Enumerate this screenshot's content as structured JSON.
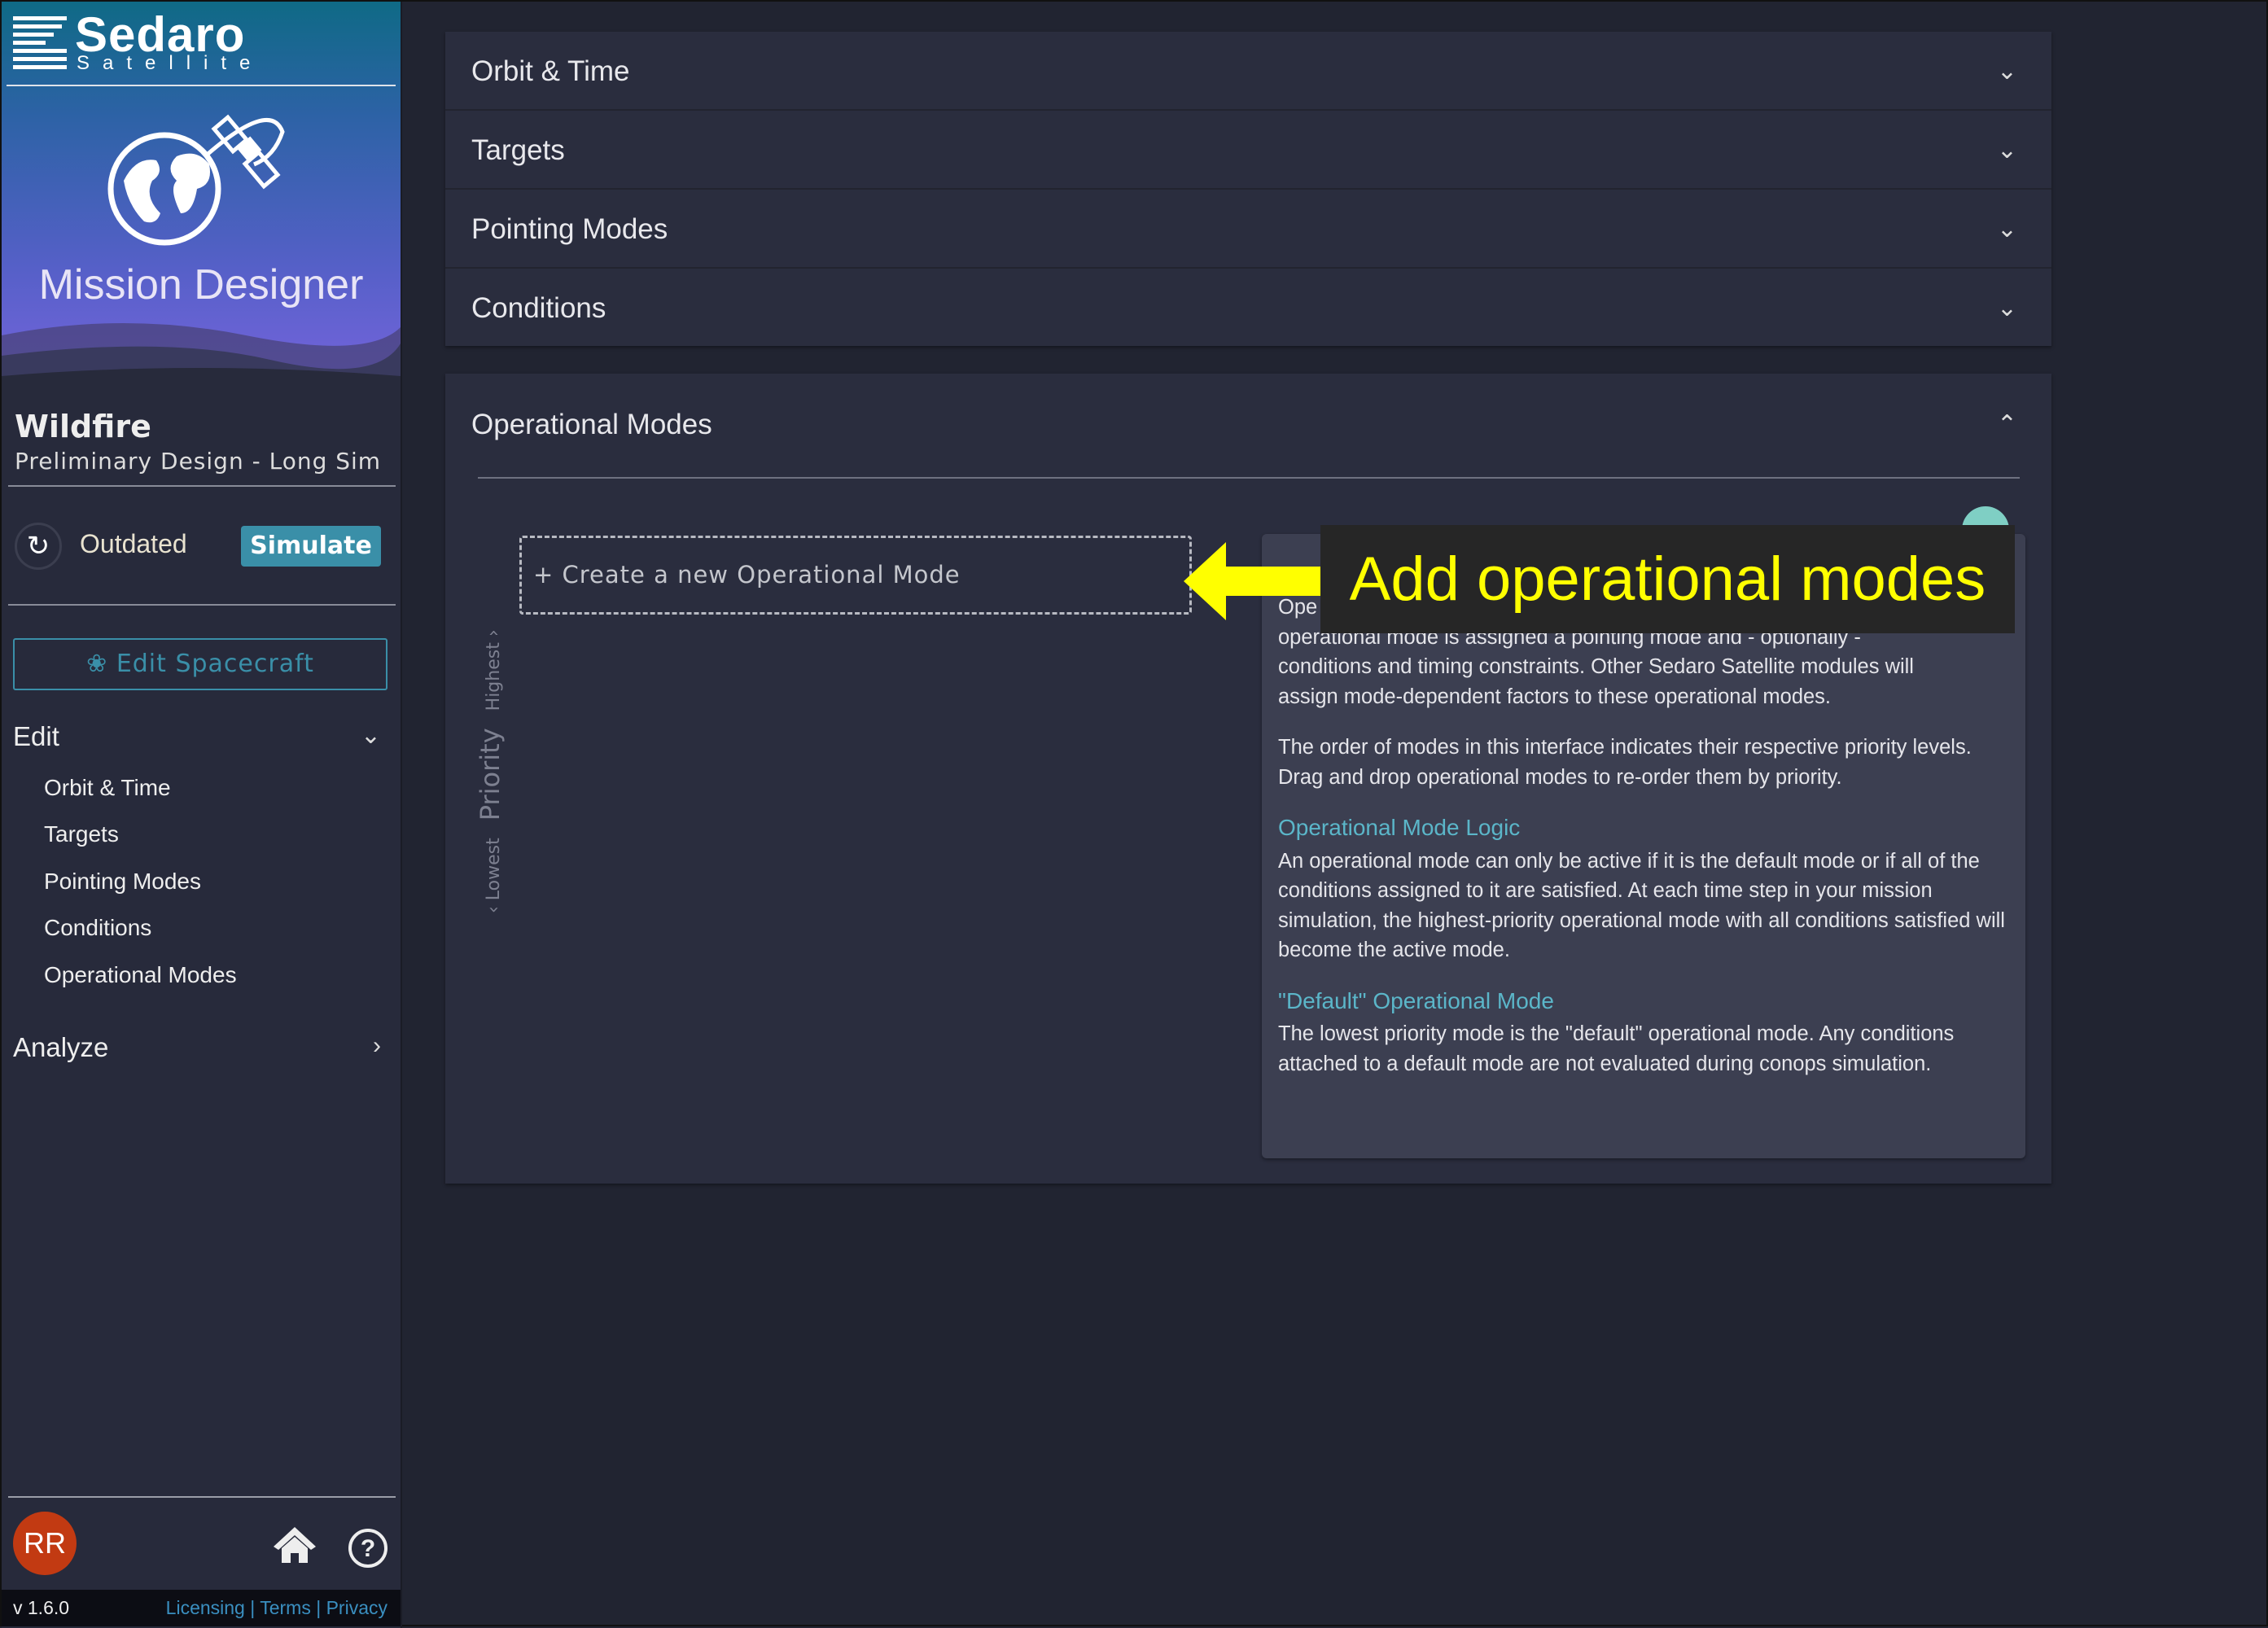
{
  "sidebar": {
    "logo": {
      "name": "Sedaro",
      "sub": "Satellite"
    },
    "app_title": "Mission Designer",
    "project": "Wildfire",
    "branch": "Preliminary Design - Long Sim",
    "status": "Outdated",
    "simulate_label": "Simulate",
    "edit_spacecraft_label": "Edit Spacecraft",
    "edit_section": {
      "label": "Edit",
      "items": [
        "Orbit & Time",
        "Targets",
        "Pointing Modes",
        "Conditions",
        "Operational Modes"
      ]
    },
    "analyze_label": "Analyze",
    "avatar_initials": "RR",
    "version": "v 1.6.0",
    "links": [
      "Licensing",
      "Terms",
      "Privacy"
    ]
  },
  "main": {
    "accordions": [
      "Orbit & Time",
      "Targets",
      "Pointing Modes",
      "Conditions"
    ],
    "operational_modes": {
      "title": "Operational Modes",
      "create_label": "+ Create a new Operational Mode",
      "priority": {
        "label": "Priority",
        "highest": "Highest",
        "lowest": "Lowest"
      },
      "help": {
        "p1_lines": [
          "Ope",
          "operational mode is assigned a pointing mode and - optionally -",
          "conditions and timing constraints. Other Sedaro Satellite modules will",
          "assign mode-dependent factors to these operational modes."
        ],
        "p2": "The order of modes in this interface indicates their respective priority levels. Drag and drop operational modes to re-order them by priority.",
        "h1": "Operational Mode Logic",
        "p3": "An operational mode can only be active if it is the default mode or if all of the conditions assigned to it are satisfied. At each time step in your mission simulation, the highest-priority operational mode with all conditions satisfied will become the active mode.",
        "h2": "\"Default\" Operational Mode",
        "p4": "The lowest priority mode is the \"default\" operational mode. Any conditions attached to a default mode are not evaluated during conops simulation."
      }
    }
  },
  "annotation": {
    "text": "Add operational modes",
    "color": "#ffff00"
  },
  "colors": {
    "accent": "#3a8fa8",
    "avatar": "#c23a12",
    "help_heading": "#5bb6c9"
  }
}
